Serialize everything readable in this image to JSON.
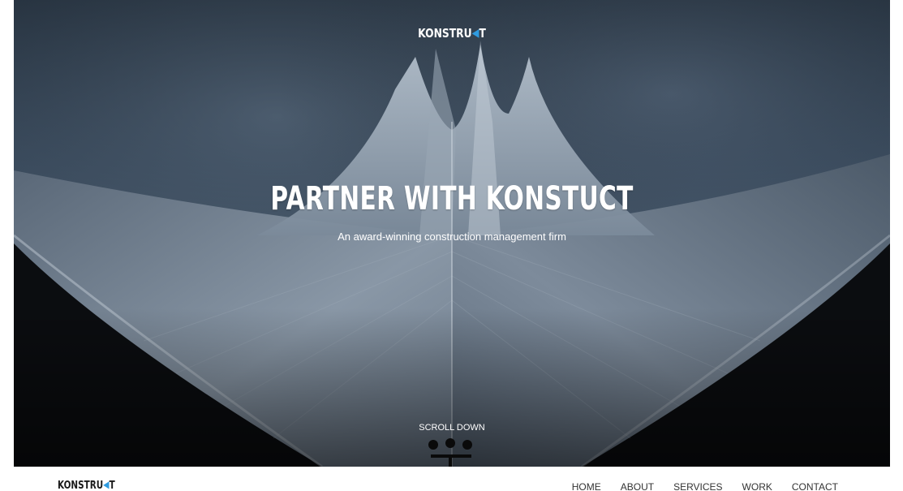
{
  "hero": {
    "logo_main": "KONSTRU",
    "logo_accent": "K",
    "logo_end": "T",
    "title": "PARTNER WITH KONSTUCT",
    "subtitle": "An award-winning construction management firm",
    "scroll_label": "SCROLL DOWN"
  },
  "nav": {
    "logo_main": "KONSTRU",
    "logo_accent": "K",
    "logo_end": "T",
    "links": [
      "HOME",
      "ABOUT",
      "SERVICES",
      "WORK",
      "CONTACT"
    ]
  },
  "colors": {
    "accent": "#2f9be0",
    "sky": "#2f3f52",
    "roof": "#8a97a6",
    "ground": "#0b0d10"
  }
}
